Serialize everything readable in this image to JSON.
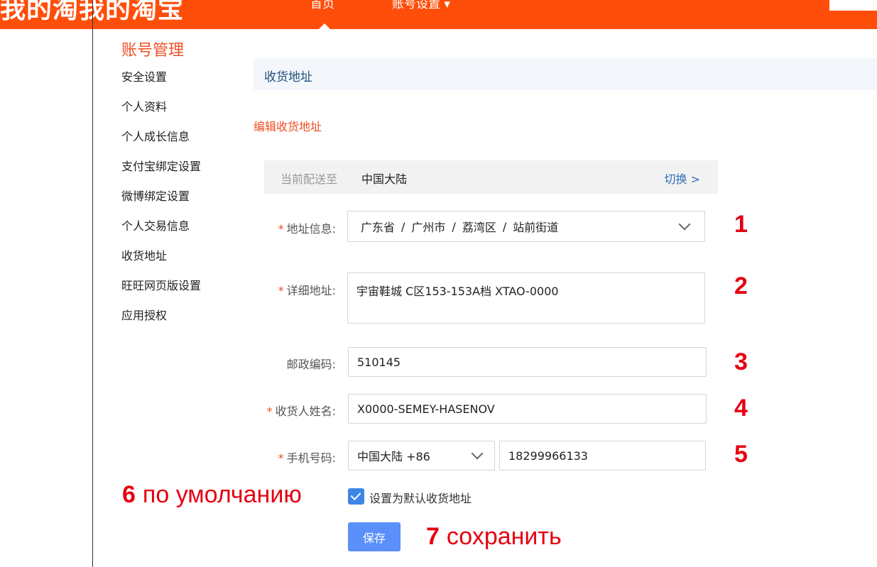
{
  "header": {
    "logo_text": "我的淘我的淘宝",
    "nav_home": "首页",
    "nav_account": "账号设置 ▾"
  },
  "sidebar": {
    "title": "账号管理",
    "items": [
      {
        "label": "安全设置"
      },
      {
        "label": "个人资料"
      },
      {
        "label": "个人成长信息"
      },
      {
        "label": "支付宝绑定设置"
      },
      {
        "label": "微博绑定设置"
      },
      {
        "label": "个人交易信息"
      },
      {
        "label": "收货地址"
      },
      {
        "label": "旺旺网页版设置"
      },
      {
        "label": "应用授权"
      }
    ]
  },
  "main": {
    "section_title": "收货地址",
    "edit_title": "编辑收货地址",
    "destination": {
      "label": "当前配送至",
      "value": "中国大陆",
      "switch_label": "切换 >"
    },
    "form": {
      "address": {
        "required": "*",
        "label": "地址信息:",
        "province": "广东省",
        "city": "广州市",
        "district": "荔湾区",
        "street": "站前街道",
        "sep": "/"
      },
      "detail": {
        "required": "*",
        "label": "详细地址:",
        "value": "宇宙鞋城 C区153-153A档 XTAO-0000"
      },
      "postcode": {
        "label": "邮政编码:",
        "value": "510145"
      },
      "name": {
        "required": "*",
        "label": "收货人姓名:",
        "value": "X0000-SEMEY-HASENOV"
      },
      "phone": {
        "required": "*",
        "label": "手机号码:",
        "country": "中国大陆 +86",
        "number": "18299966133"
      },
      "default_checkbox_label": "设置为默认收货地址",
      "save_label": "保存"
    }
  },
  "annotations": {
    "n1": "1",
    "n2": "2",
    "n3": "3",
    "n4": "4",
    "n5": "5",
    "n6": "6",
    "n6_text": "по умолчанию",
    "n7": "7",
    "n7_text": "сохранить",
    "color": "#e60012"
  },
  "colors": {
    "brand": "#ff4e0a",
    "accent": "#f04e23",
    "link": "#2e6fb8",
    "button": "#5b8ff9"
  }
}
